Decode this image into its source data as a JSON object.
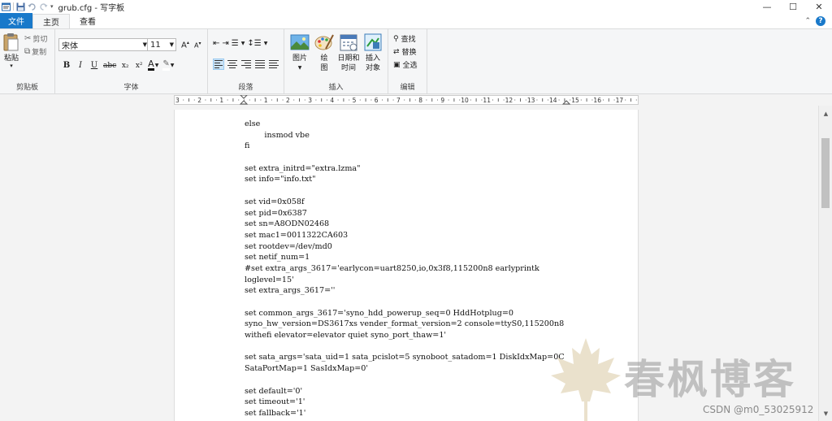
{
  "window": {
    "title": "grub.cfg - 写字板",
    "controls": [
      "—",
      "☐",
      "✕"
    ]
  },
  "tabs": {
    "file": "文件",
    "home": "主页",
    "view": "查看"
  },
  "ribbon": {
    "clipboard": {
      "paste": "粘贴",
      "cut": "剪切",
      "copy": "复制",
      "label": "剪贴板"
    },
    "font": {
      "family": "宋体",
      "size": "11",
      "bold": "B",
      "italic": "I",
      "underline": "U",
      "strike": "abc",
      "subscript": "x₂",
      "superscript": "x²",
      "label": "字体"
    },
    "paragraph": {
      "label": "段落"
    },
    "insert": {
      "picture": "图片",
      "paint": "绘图",
      "datetime_1": "日期和",
      "datetime_2": "时间",
      "object_1": "插入",
      "object_2": "对象",
      "label": "插入"
    },
    "edit": {
      "find": "查找",
      "replace": "替换",
      "select_all": "全选",
      "label": "编辑"
    }
  },
  "ruler": {
    "labels": [
      "3",
      "2",
      "1",
      "1",
      "2",
      "3",
      "4",
      "5",
      "6",
      "7",
      "8",
      "9",
      "10",
      "11",
      "12",
      "13",
      "14",
      "15",
      "16",
      "17"
    ]
  },
  "document": {
    "lines": [
      "else",
      "        insmod vbe",
      "fi",
      "",
      "set extra_initrd=\"extra.lzma\"",
      "set info=\"info.txt\"",
      "",
      "set vid=0x058f",
      "set pid=0x6387",
      "set sn=A8ODN02468",
      "set mac1=0011322CA603",
      "set rootdev=/dev/md0",
      "set netif_num=1",
      "#set extra_args_3617='earlycon=uart8250,io,0x3f8,115200n8 earlyprintk",
      "loglevel=15'",
      "set extra_args_3617=''",
      "",
      "set common_args_3617='syno_hdd_powerup_seq=0 HddHotplug=0",
      "syno_hw_version=DS3617xs vender_format_version=2 console=ttyS0,115200n8",
      "withefi elevator=elevator quiet syno_port_thaw=1'",
      "",
      "set sata_args='sata_uid=1 sata_pcislot=5 synoboot_satadom=1 DiskIdxMap=0C",
      "SataPortMap=1 SasIdxMap=0'",
      "",
      "set default='0'",
      "set timeout='1'",
      "set fallback='1'"
    ]
  },
  "watermark": {
    "text": "春枫博客",
    "credit": "CSDN @m0_53025912"
  }
}
